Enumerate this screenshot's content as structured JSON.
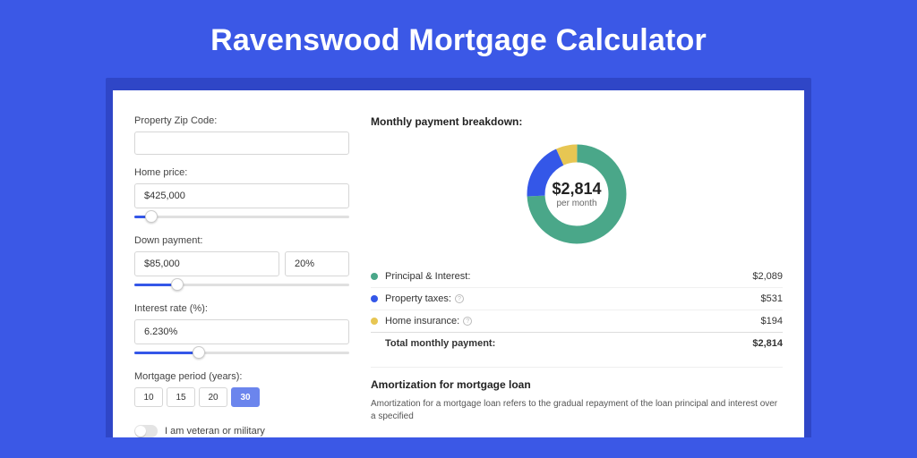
{
  "title": "Ravenswood Mortgage Calculator",
  "form": {
    "zip_label": "Property Zip Code:",
    "zip_value": "",
    "home_price_label": "Home price:",
    "home_price_value": "$425,000",
    "home_price_slider_pct": 8,
    "down_payment_label": "Down payment:",
    "down_payment_value": "$85,000",
    "down_payment_pct": "20%",
    "down_payment_slider_pct": 20,
    "interest_label": "Interest rate (%):",
    "interest_value": "6.230%",
    "interest_slider_pct": 30,
    "period_label": "Mortgage period (years):",
    "periods": [
      "10",
      "15",
      "20",
      "30"
    ],
    "period_active_index": 3,
    "veteran_label": "I am veteran or military"
  },
  "breakdown": {
    "heading": "Monthly payment breakdown:",
    "center_amount": "$2,814",
    "center_sub": "per month",
    "items": [
      {
        "label": "Principal & Interest:",
        "value": "$2,089",
        "color": "#4aa789",
        "has_info": false
      },
      {
        "label": "Property taxes:",
        "value": "$531",
        "color": "#3457e8",
        "has_info": true
      },
      {
        "label": "Home insurance:",
        "value": "$194",
        "color": "#e7c653",
        "has_info": true
      }
    ],
    "total_label": "Total monthly payment:",
    "total_value": "$2,814"
  },
  "chart_data": {
    "type": "pie",
    "title": "Monthly payment breakdown",
    "series": [
      {
        "name": "Principal & Interest",
        "value": 2089,
        "color": "#4aa789"
      },
      {
        "name": "Property taxes",
        "value": 531,
        "color": "#3457e8"
      },
      {
        "name": "Home insurance",
        "value": 194,
        "color": "#e7c653"
      }
    ],
    "total": 2814,
    "center_label": "$2,814 per month"
  },
  "amortization": {
    "heading": "Amortization for mortgage loan",
    "text": "Amortization for a mortgage loan refers to the gradual repayment of the loan principal and interest over a specified"
  }
}
